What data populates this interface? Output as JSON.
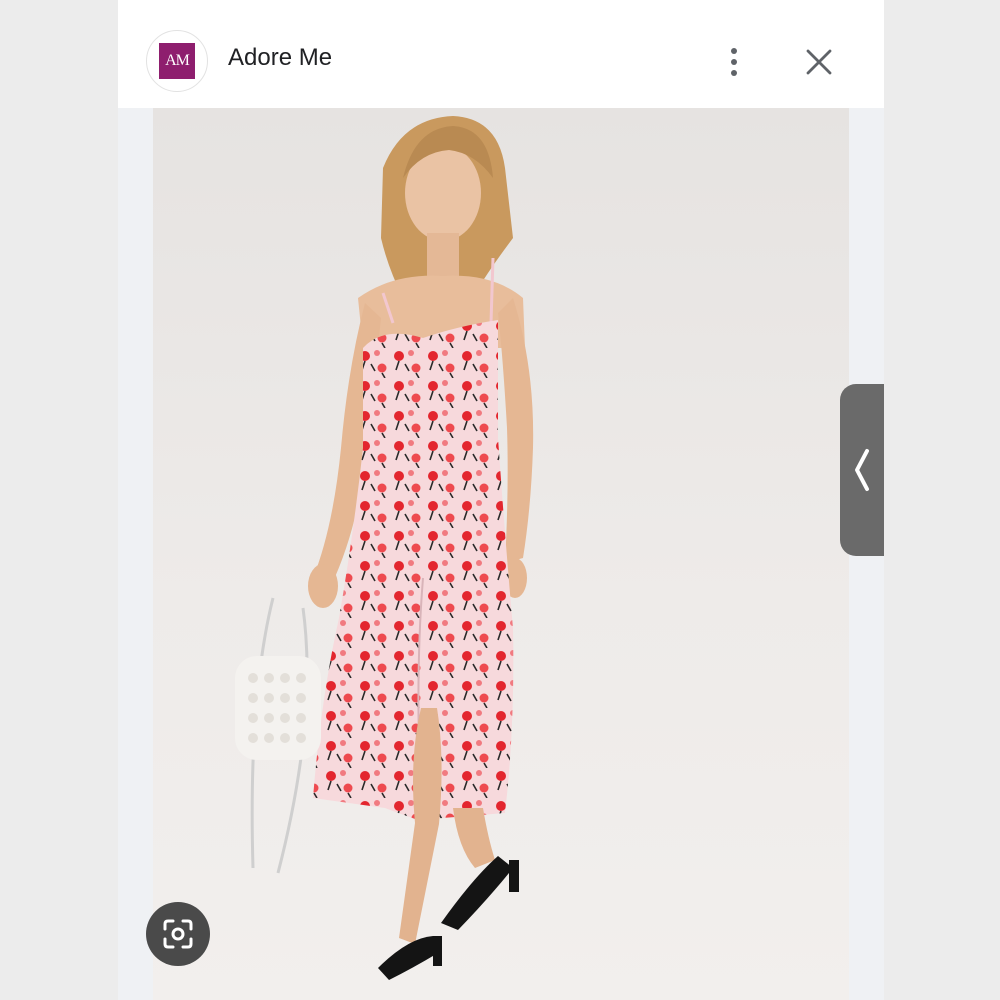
{
  "header": {
    "logo_text": "AM",
    "site_name": "Adore Me",
    "more_icon": "more-vert-icon",
    "close_icon": "close-icon"
  },
  "image": {
    "subject": "product-photo",
    "lens_icon": "lens-search-icon"
  },
  "side_handle": {
    "icon": "chevron-left-icon"
  },
  "colors": {
    "brand": "#8e1e6e",
    "handle": "#6a6a6a",
    "lens_button": "#4a4a4a"
  }
}
